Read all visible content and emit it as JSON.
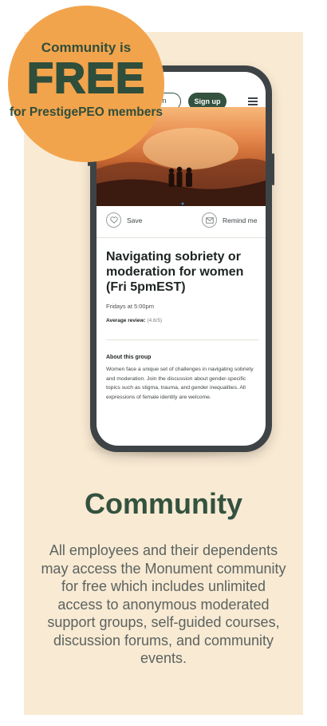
{
  "badge": {
    "line1": "Community is",
    "free": "FREE",
    "line3": "for PrestigePEO members"
  },
  "phone": {
    "header": {
      "login_label": "in",
      "signup_label": "Sign up",
      "menu_icon": "hamburger-menu-icon"
    },
    "actions": {
      "save_label": "Save",
      "save_icon": "heart-icon",
      "remind_label": "Remind me",
      "remind_icon": "mail-icon"
    },
    "group": {
      "title": "Navigating sobriety or moderation for women (Fri 5pmEST)",
      "schedule": "Fridays at 5:00pm",
      "review_label": "Average review:",
      "review_value": "(4.6/5)"
    },
    "about": {
      "heading": "About this group",
      "text": "Women face a unique set of challenges in navigating sobriety and moderation. Join the discussion about gender-specific topics such as stigma, trauma, and gender inequalities. All expressions of female identity are welcome."
    }
  },
  "section": {
    "title": "Community",
    "description": "All employees and their dependents may access the Monument community for free which includes unlimited access to anonymous moderated support groups, self-guided courses, discussion forums, and community events."
  },
  "colors": {
    "card_bg": "#f9ead3",
    "badge_bg": "#f2a44c",
    "brand_green": "#33523f",
    "phone_frame": "#3e4346"
  }
}
